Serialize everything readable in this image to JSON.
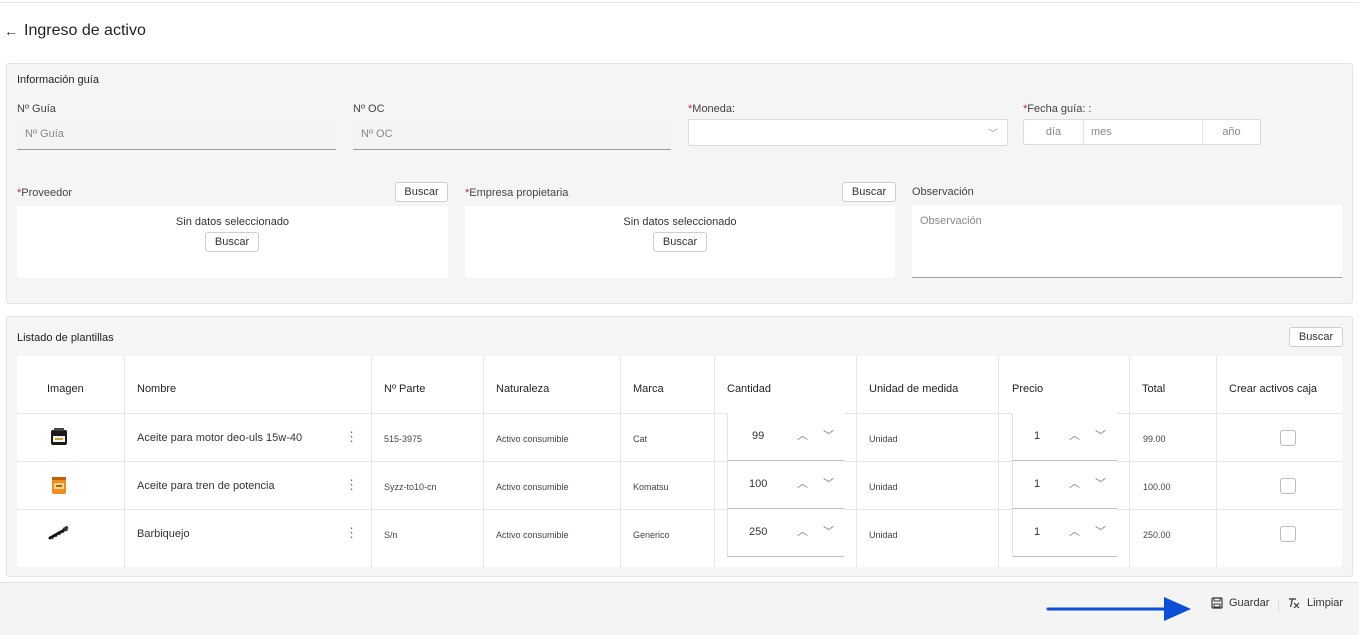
{
  "page": {
    "title": "Ingreso de activo",
    "back_icon": "arrow-left-icon"
  },
  "guia": {
    "section_title": "Información guía",
    "n_guia": {
      "label": "Nº Guía",
      "placeholder": "Nº Guía"
    },
    "n_oc": {
      "label": "Nº OC",
      "placeholder": "Nº OC"
    },
    "moneda": {
      "required_mark": "*",
      "label": "Moneda:",
      "value": ""
    },
    "fecha": {
      "required_mark": "*",
      "label": "Fecha guía: :",
      "dia": "día",
      "mes": "mes",
      "anio": "año"
    },
    "proveedor": {
      "required_mark": "*",
      "label": "Proveedor",
      "buscar": "Buscar",
      "empty": "Sin datos seleccionado",
      "inner_buscar": "Buscar"
    },
    "empresa": {
      "required_mark": "*",
      "label": "Empresa propietaria",
      "buscar": "Buscar",
      "empty": "Sin datos seleccionado",
      "inner_buscar": "Buscar"
    },
    "observacion": {
      "label": "Observación",
      "placeholder": "Observación"
    }
  },
  "listado": {
    "section_title": "Listado de plantillas",
    "buscar": "Buscar",
    "columns": [
      "Imagen",
      "Nombre",
      "Nº Parte",
      "Naturaleza",
      "Marca",
      "Cantidad",
      "Unidad de medida",
      "Precio",
      "Total",
      "Crear activos caja"
    ],
    "rows": [
      {
        "image": "oil-can-icon",
        "nombre": "Aceite para motor deo-uls 15w-40",
        "parte": "515-3975",
        "naturaleza": "Activo consumible",
        "marca": "Cat",
        "cantidad": "99",
        "unidad": "Unidad",
        "precio": "1",
        "total": "99.00",
        "crear_caja": false
      },
      {
        "image": "oil-bucket-icon",
        "nombre": "Aceite para tren de potencia",
        "parte": "Syzz-to10-cn",
        "naturaleza": "Activo consumible",
        "marca": "Komatsu",
        "cantidad": "100",
        "unidad": "Unidad",
        "precio": "1",
        "total": "100.00",
        "crear_caja": false
      },
      {
        "image": "chin-strap-icon",
        "nombre": "Barbiquejo",
        "parte": "S/n",
        "naturaleza": "Activo consumible",
        "marca": "Generico",
        "cantidad": "250",
        "unidad": "Unidad",
        "precio": "1",
        "total": "250.00",
        "crear_caja": false
      }
    ]
  },
  "footer": {
    "guardar": "Guardar",
    "limpiar": "Limpiar",
    "guardar_icon": "save-icon",
    "limpiar_icon": "clear-format-icon"
  },
  "colors": {
    "arrow": "#0b4fd9",
    "required": "#c62828",
    "card_bg": "#f5f5f5"
  }
}
